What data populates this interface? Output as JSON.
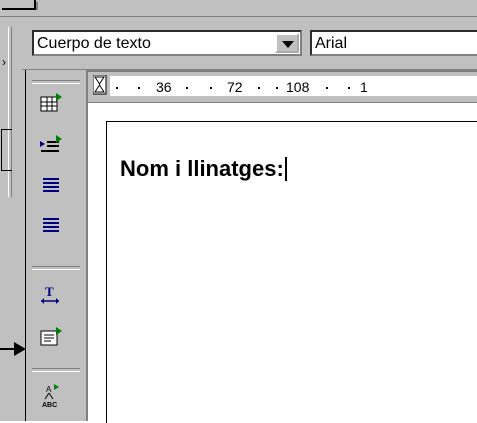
{
  "format_toolbar": {
    "paragraph_style": "Cuerpo de texto",
    "font_name": "Arial",
    "dropdown_icon": "chevron-down-icon"
  },
  "ruler": {
    "labels": [
      "36",
      "72",
      "108",
      "1"
    ]
  },
  "document": {
    "text": "Nom i llinatges:"
  },
  "vertical_toolbar": {
    "icons": [
      "insert-table-icon",
      "insert-list-icon",
      "align-icon",
      "justify-icon",
      "text-direction-icon",
      "insert-field-icon",
      "spellcheck-icon"
    ]
  },
  "colors": {
    "chrome": "#c0c0c0",
    "icon_blue": "#000080",
    "icon_green": "#008000"
  }
}
